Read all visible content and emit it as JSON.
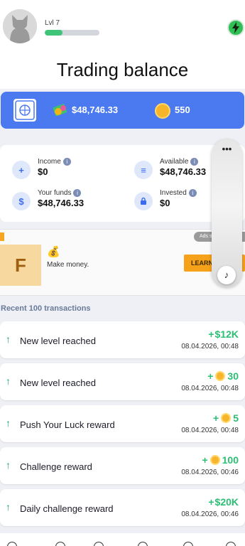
{
  "header": {
    "level_label": "Lvl 7",
    "xp_progress": 0.32,
    "avatar_icon": "cat-avatar",
    "boost_icon": "lightning-icon"
  },
  "page_title": "Trading balance",
  "balance": {
    "usd": "$48,746.33",
    "coins": "550",
    "safe_icon": "safe-icon",
    "money_icon": "money-icon",
    "coin_icon": "coin-icon"
  },
  "stats": {
    "income": {
      "label": "Income",
      "value": "$0",
      "icon": "plus-icon"
    },
    "available": {
      "label": "Available",
      "value": "$48,746.33",
      "icon": "coins-stack-icon"
    },
    "funds": {
      "label": "Your funds",
      "value": "$48,746.33",
      "icon": "dollar-icon"
    },
    "invested": {
      "label": "Invested",
      "value": "$0",
      "icon": "lock-icon"
    }
  },
  "ad": {
    "logo_letter": "F",
    "tagline": "Make money.",
    "cta": "LEARN",
    "tag": "Ads s"
  },
  "transactions_heading": "Recent 100 transactions",
  "transactions": [
    {
      "label": "New level reached",
      "prefix": "+",
      "amount": "$12K",
      "coin": false,
      "date": "08.04.2026, 00:48"
    },
    {
      "label": "New level reached",
      "prefix": "+",
      "amount": "30",
      "coin": true,
      "date": "08.04.2026, 00:48"
    },
    {
      "label": "Push Your Luck reward",
      "prefix": "+",
      "amount": "5",
      "coin": true,
      "date": "08.04.2026, 00:48"
    },
    {
      "label": "Challenge reward",
      "prefix": "+",
      "amount": "100",
      "coin": true,
      "date": "08.04.2026, 00:46"
    },
    {
      "label": "Daily challenge reward",
      "prefix": "+",
      "amount": "$20K",
      "coin": false,
      "date": "08.04.2026, 00:46"
    }
  ],
  "colors": {
    "accent": "#4a79f0",
    "positive": "#2bbf73",
    "coin": "#f7b52b"
  }
}
